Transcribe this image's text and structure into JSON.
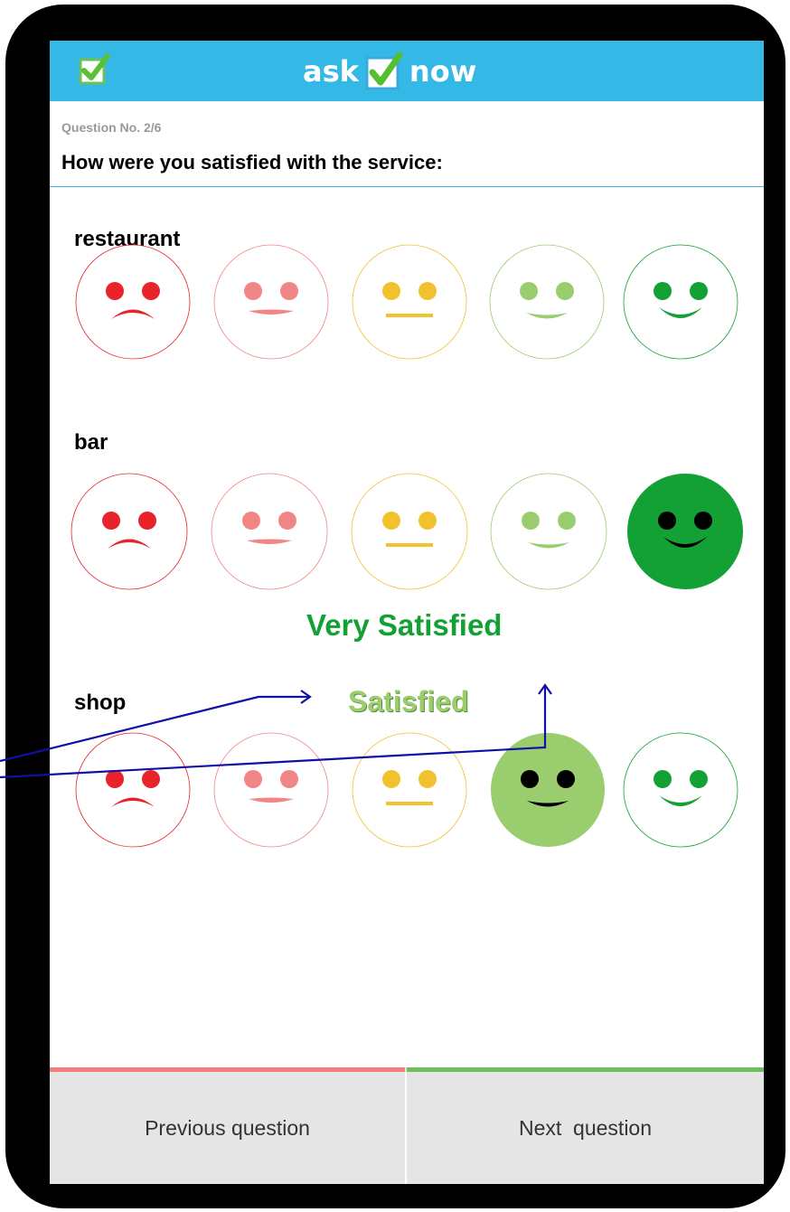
{
  "header": {
    "logo_left": "ask",
    "logo_right": "now",
    "menu_icon": "checkbox-icon"
  },
  "question": {
    "number": "Question No. 2/6",
    "text": "How were you satisfied with the service:"
  },
  "categories": [
    {
      "label": "restaurant",
      "selected_level": null,
      "selected_text": ""
    },
    {
      "label": "bar",
      "selected_level": 5,
      "selected_text": "Very Satisfied"
    },
    {
      "label": "shop",
      "selected_level": 4,
      "selected_text": "Satisfied"
    }
  ],
  "face_icons": [
    "very-dissatisfied-face-icon",
    "dissatisfied-face-icon",
    "neutral-face-icon",
    "satisfied-face-icon",
    "very-satisfied-face-icon"
  ],
  "colors": {
    "header_bg": "#34b8e6",
    "very_dissatisfied": "#e8232a",
    "dissatisfied": "#f28585",
    "neutral": "#f2c12e",
    "satisfied": "#9acd6e",
    "very_satisfied": "#13a034",
    "annotation": "#1010a8",
    "prev_bar": "#f47c7c",
    "next_bar": "#6cc05a"
  },
  "footer": {
    "prev_label": "Previous question",
    "next_label": "Next  question"
  }
}
